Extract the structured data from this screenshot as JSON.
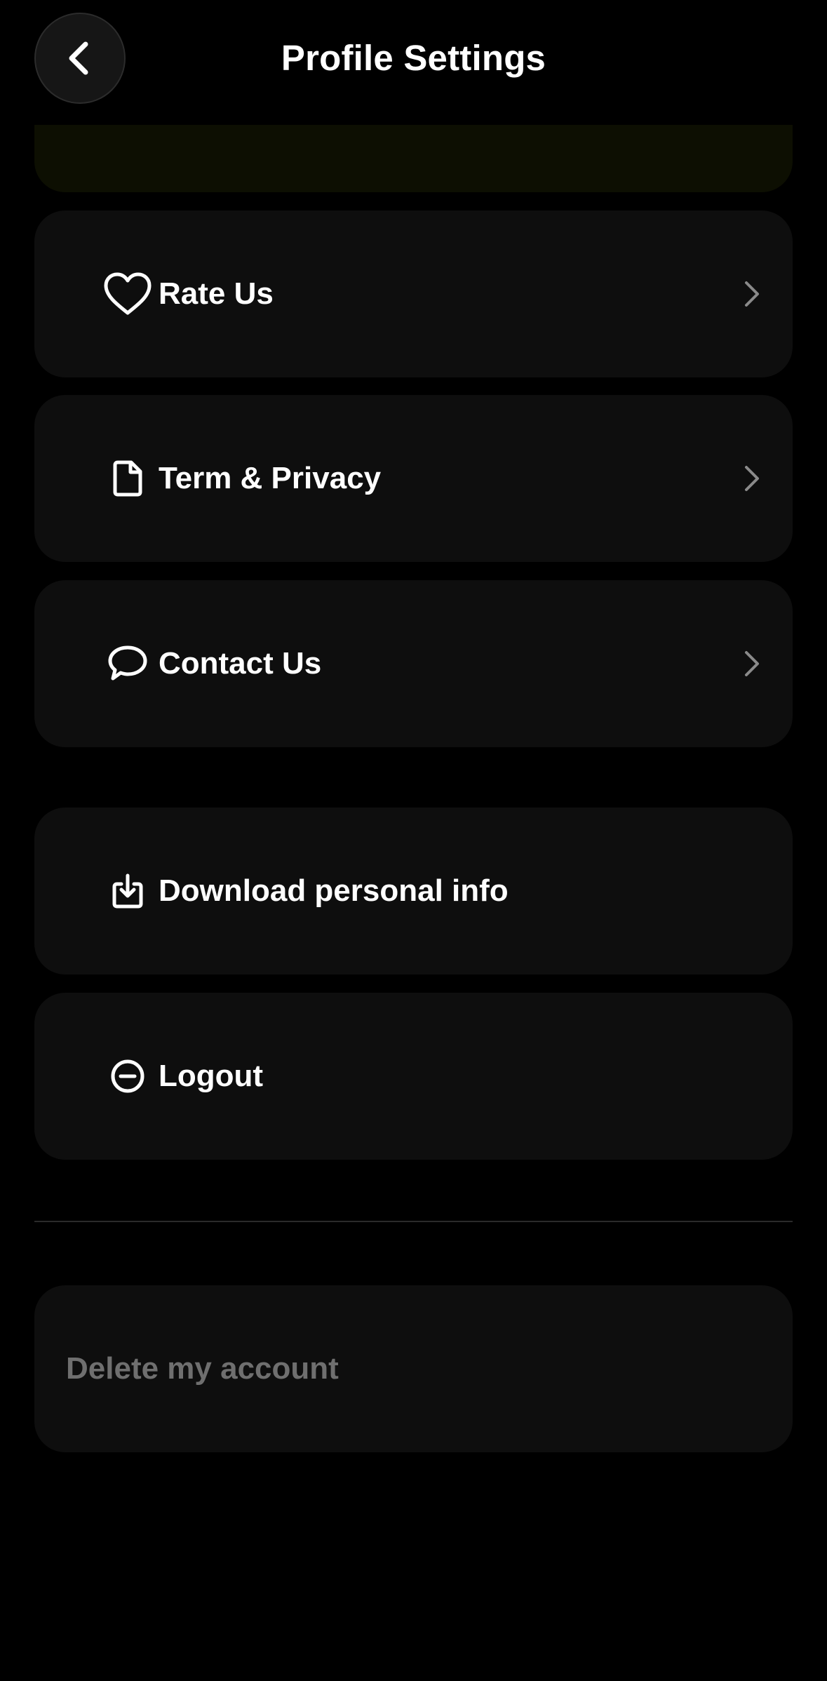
{
  "header": {
    "title": "Profile Settings",
    "back_icon": "chevron-left-icon"
  },
  "colors": {
    "background": "#000000",
    "card": "#0e0e0e",
    "partial_card": "#0d0f02",
    "text": "#ffffff",
    "muted_text": "#6f6f6f",
    "chevron": "#8a8a8a"
  },
  "menu": {
    "rate": {
      "label": "Rate Us",
      "icon": "heart-icon"
    },
    "terms": {
      "label": "Term & Privacy",
      "icon": "document-icon"
    },
    "contact": {
      "label": "Contact Us",
      "icon": "chat-bubble-icon"
    },
    "download": {
      "label": "Download personal info",
      "icon": "download-icon"
    },
    "logout": {
      "label": "Logout",
      "icon": "minus-circle-icon"
    }
  },
  "danger": {
    "delete_label": "Delete my account"
  }
}
